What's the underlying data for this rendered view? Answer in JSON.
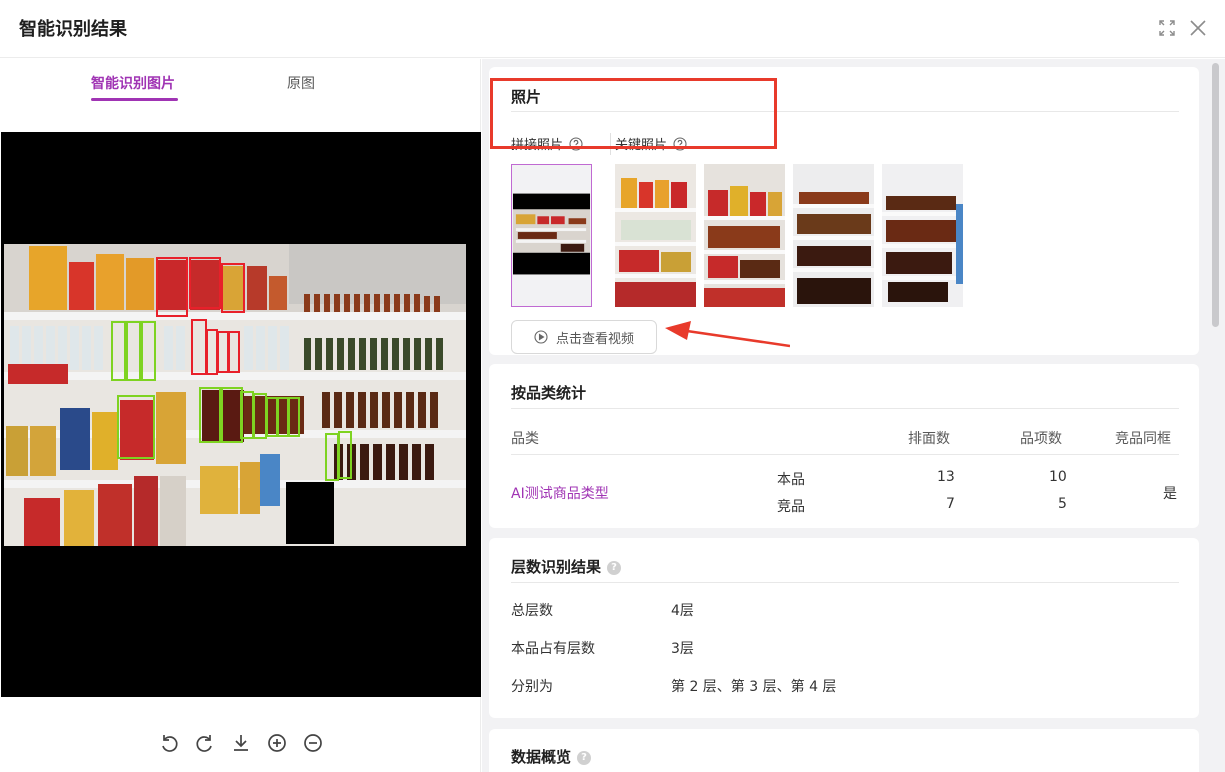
{
  "dialog": {
    "title": "智能识别结果"
  },
  "left": {
    "tabs": [
      {
        "label": "智能识别图片",
        "active": true
      },
      {
        "label": "原图",
        "active": false
      }
    ],
    "toolbar": [
      "rotate-left-icon",
      "rotate-right-icon",
      "download-icon",
      "zoom-in-icon",
      "zoom-out-icon"
    ]
  },
  "photos": {
    "title": "照片",
    "tabs": [
      {
        "label": "拼接照片"
      },
      {
        "label": "关键照片"
      }
    ],
    "video_button": "点击查看视频"
  },
  "category_stats": {
    "title": "按品类统计",
    "headers": [
      "品类",
      "排面数",
      "品项数",
      "竞品同框"
    ],
    "row": {
      "category": "AI测试商品类型",
      "own_label": "本品",
      "comp_label": "竞品",
      "own_facings": "13",
      "comp_facings": "7",
      "own_items": "10",
      "comp_items": "5",
      "same_frame": "是"
    }
  },
  "layers": {
    "title": "层数识别结果",
    "rows": [
      {
        "key": "总层数",
        "value": "4层"
      },
      {
        "key": "本品占有层数",
        "value": "3层"
      },
      {
        "key": "分别为",
        "value": "第 2 层、第 3 层、第 4 层"
      }
    ]
  },
  "overview": {
    "title": "数据概览"
  },
  "colors": {
    "accent": "#a034b4",
    "highlight_red": "#e83a2b",
    "own_box": "#e8202a",
    "comp_box": "#7ed321"
  }
}
